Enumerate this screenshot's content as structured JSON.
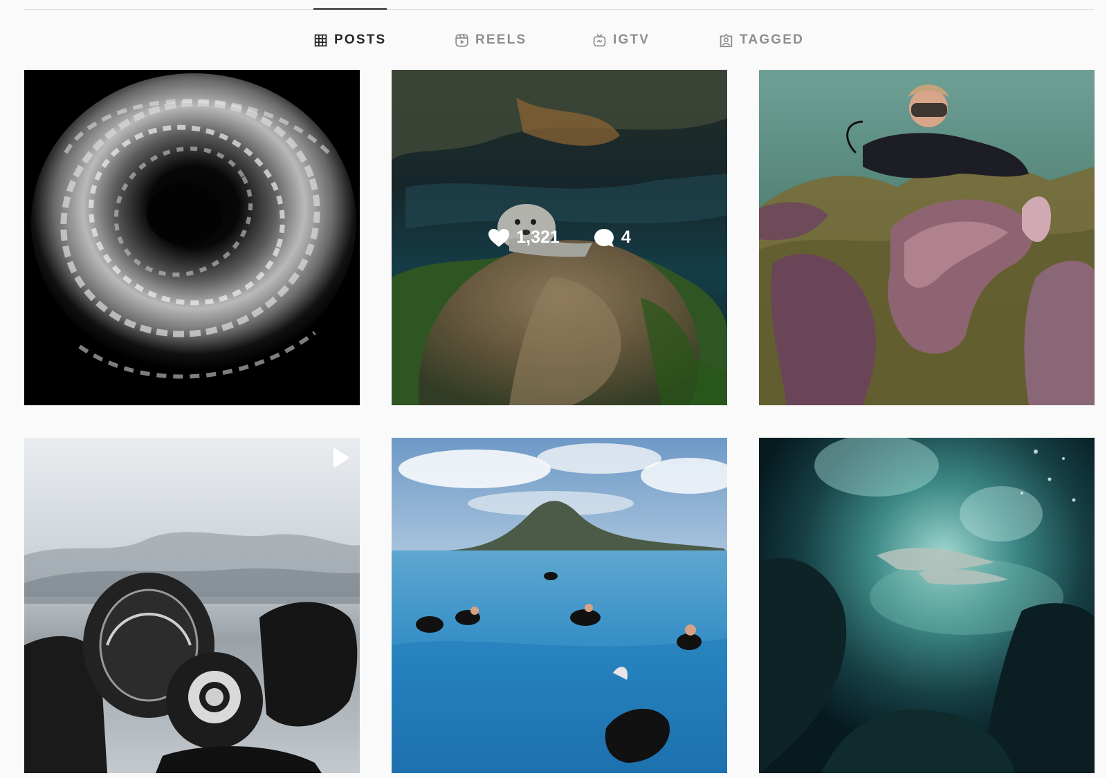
{
  "tabs": [
    {
      "label": "POSTS",
      "icon": "grid-icon",
      "active": true
    },
    {
      "label": "REELS",
      "icon": "reels-icon",
      "active": false
    },
    {
      "label": "IGTV",
      "icon": "igtv-icon",
      "active": false
    },
    {
      "label": "TAGGED",
      "icon": "tagged-icon",
      "active": false
    }
  ],
  "posts": [
    {
      "type": "photo",
      "subject": "school-of-fish"
    },
    {
      "type": "photo",
      "subject": "seal-on-rock",
      "hover": {
        "likes": "1,321",
        "comments": "4"
      }
    },
    {
      "type": "photo",
      "subject": "diver-with-cuttlefish"
    },
    {
      "type": "reel",
      "subject": "dive-regulator",
      "badge": "play-icon"
    },
    {
      "type": "photo",
      "subject": "divers-near-island"
    },
    {
      "type": "photo",
      "subject": "sharks-in-cave"
    }
  ],
  "colors": {
    "background": "#fafafa",
    "active_tab": "#262626",
    "inactive_tab": "#8e8e8e",
    "divider": "#dbdbdb"
  }
}
